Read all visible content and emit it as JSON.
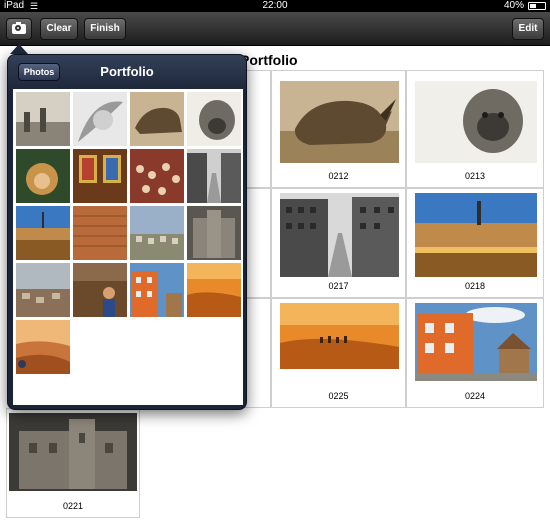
{
  "status_bar": {
    "carrier": "iPad",
    "time": "22:00",
    "battery": "40%"
  },
  "toolbar": {
    "camera_icon": "camera-icon",
    "clear_label": "Clear",
    "finish_label": "Finish",
    "edit_label": "Edit"
  },
  "page": {
    "title": "Portfolio"
  },
  "grid": {
    "items": [
      {
        "id": "0212",
        "subject": "rhinoceros"
      },
      {
        "id": "0213",
        "subject": "gorilla"
      },
      {
        "id": "0217",
        "subject": "city-canal"
      },
      {
        "id": "0218",
        "subject": "harbor-town"
      },
      {
        "id": "0225",
        "subject": "desert-sunset"
      },
      {
        "id": "0224",
        "subject": "orange-house"
      },
      {
        "id": "0221",
        "subject": "stone-fortress"
      }
    ]
  },
  "popover": {
    "back_label": "Photos",
    "title": "Portfolio",
    "photo_count": 17
  },
  "colors": {
    "toolbar": "#2b2b2b",
    "popover": "#1b2436",
    "grid_border": "#cfcfcf"
  }
}
